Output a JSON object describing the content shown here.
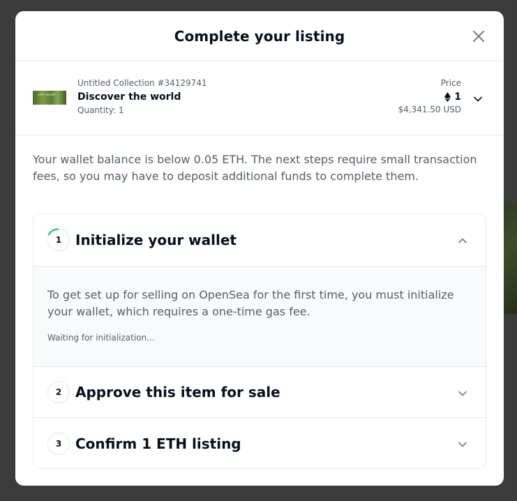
{
  "modal": {
    "title": "Complete your listing"
  },
  "item": {
    "collection": "Untitled Collection #34129741",
    "name": "Discover the world",
    "quantity": "Quantity: 1",
    "thumbnail_caption": "the world",
    "price_label": "Price",
    "price_eth": "1",
    "price_usd": "$4,341.50 USD"
  },
  "warning": "Your wallet balance is below 0.05 ETH. The next steps require small transaction fees, so you may have to deposit additional funds to complete them.",
  "steps": [
    {
      "number": "1",
      "title": "Initialize your wallet",
      "description": "To get set up for selling on OpenSea for the first time, you must initialize your wallet, which requires a one-time gas fee.",
      "status": "Waiting for initialization...",
      "expanded": true
    },
    {
      "number": "2",
      "title": "Approve this item for sale",
      "expanded": false
    },
    {
      "number": "3",
      "title": "Confirm 1 ETH listing",
      "expanded": false
    }
  ],
  "colors": {
    "progress_arc": "#34c77b",
    "text_primary": "#04111d",
    "text_secondary": "#545e66",
    "border": "#e5e8eb"
  },
  "icons": {
    "close": "close-icon",
    "eth": "ethereum-icon",
    "chevron_down": "chevron-down-icon",
    "chevron_up": "chevron-up-icon"
  }
}
